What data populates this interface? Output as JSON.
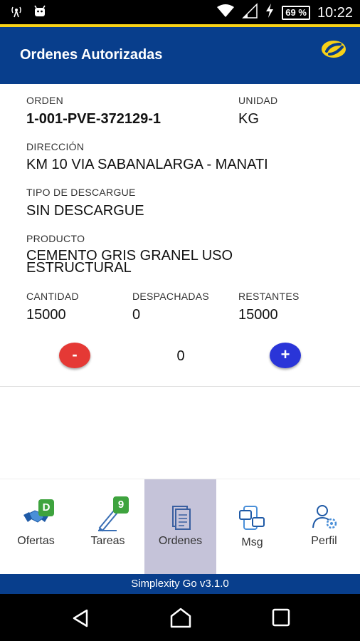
{
  "status_bar": {
    "time": "10:22",
    "battery": "69 %",
    "icons": [
      "radio-tower-icon",
      "android-icon",
      "wifi-icon",
      "cell-signal-icon",
      "charging-icon",
      "battery-icon"
    ]
  },
  "app_bar": {
    "title": "Ordenes Autorizadas",
    "logo": "brand-logo-icon"
  },
  "order": {
    "orden_label": "ORDEN",
    "orden_value": "1-001-PVE-372129-1",
    "unidad_label": "UNIDAD",
    "unidad_value": "KG",
    "direccion_label": "DIRECCIÓN",
    "direccion_value": "KM 10 VIA SABANALARGA - MANATI",
    "descargue_label": "TIPO DE DESCARGUE",
    "descargue_value": "SIN DESCARGUE",
    "producto_label": "PRODUCTO",
    "producto_value": "CEMENTO GRIS GRANEL USO ESTRUCTURAL",
    "cantidad_label": "CANTIDAD",
    "cantidad_value": "15000",
    "despachadas_label": "DESPACHADAS",
    "despachadas_value": "0",
    "restantes_label": "RESTANTES",
    "restantes_value": "15000"
  },
  "counter": {
    "minus_label": "-",
    "value": "0",
    "plus_label": "+"
  },
  "bottom_nav": {
    "items": [
      {
        "label": "Ofertas",
        "icon": "handshake-icon",
        "badge": "D"
      },
      {
        "label": "Tareas",
        "icon": "task-pen-icon",
        "badge": "9"
      },
      {
        "label": "Ordenes",
        "icon": "orders-document-icon",
        "active": true
      },
      {
        "label": "Msg",
        "icon": "messages-icon"
      },
      {
        "label": "Perfil",
        "icon": "profile-settings-icon"
      }
    ]
  },
  "version": "Simplexity Go v3.1.0",
  "colors": {
    "app_bar": "#083e8c",
    "accent": "#f7d117",
    "minus_button": "#e53935",
    "plus_button": "#2a35d8",
    "badge": "#3ea33e",
    "active_tab": "#c5c3d9"
  }
}
